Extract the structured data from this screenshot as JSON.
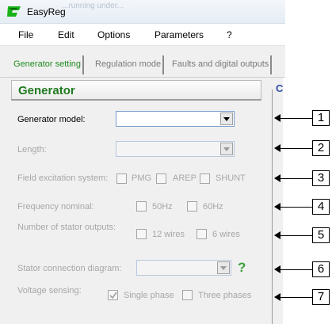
{
  "window": {
    "title": "EasyReg",
    "ghost_text": "...running under..."
  },
  "menu": [
    "File",
    "Edit",
    "Options",
    "Parameters",
    "?"
  ],
  "tabs": [
    "Generator setting",
    "Regulation mode",
    "Faults and digital outputs"
  ],
  "section": {
    "title": "Generator",
    "side_letter": "C"
  },
  "fields": {
    "generator_model": {
      "label": "Generator model:",
      "value": ""
    },
    "length": {
      "label": "Length:",
      "value": ""
    },
    "field_excitation": {
      "label": "Field excitation system:",
      "options": [
        "PMG",
        "AREP",
        "SHUNT"
      ]
    },
    "frequency": {
      "label": "Frequency nominal:",
      "options": [
        "50Hz",
        "60Hz"
      ]
    },
    "stator_outputs": {
      "label": "Number of stator outputs:",
      "options": [
        "12 wires",
        "6 wires"
      ]
    },
    "stator_connection": {
      "label": "Stator connection diagram:",
      "value": "",
      "help": "?"
    },
    "voltage_sensing": {
      "label": "Voltage sensing:",
      "options": [
        "Single phase",
        "Three phases"
      ],
      "checked": "Single phase"
    }
  },
  "callouts": [
    "1",
    "2",
    "3",
    "4",
    "5",
    "6",
    "7"
  ],
  "colors": {
    "accent_green": "#1f7a1f",
    "tab_active": "#208a20",
    "disabled_text": "#a7a7a7"
  }
}
